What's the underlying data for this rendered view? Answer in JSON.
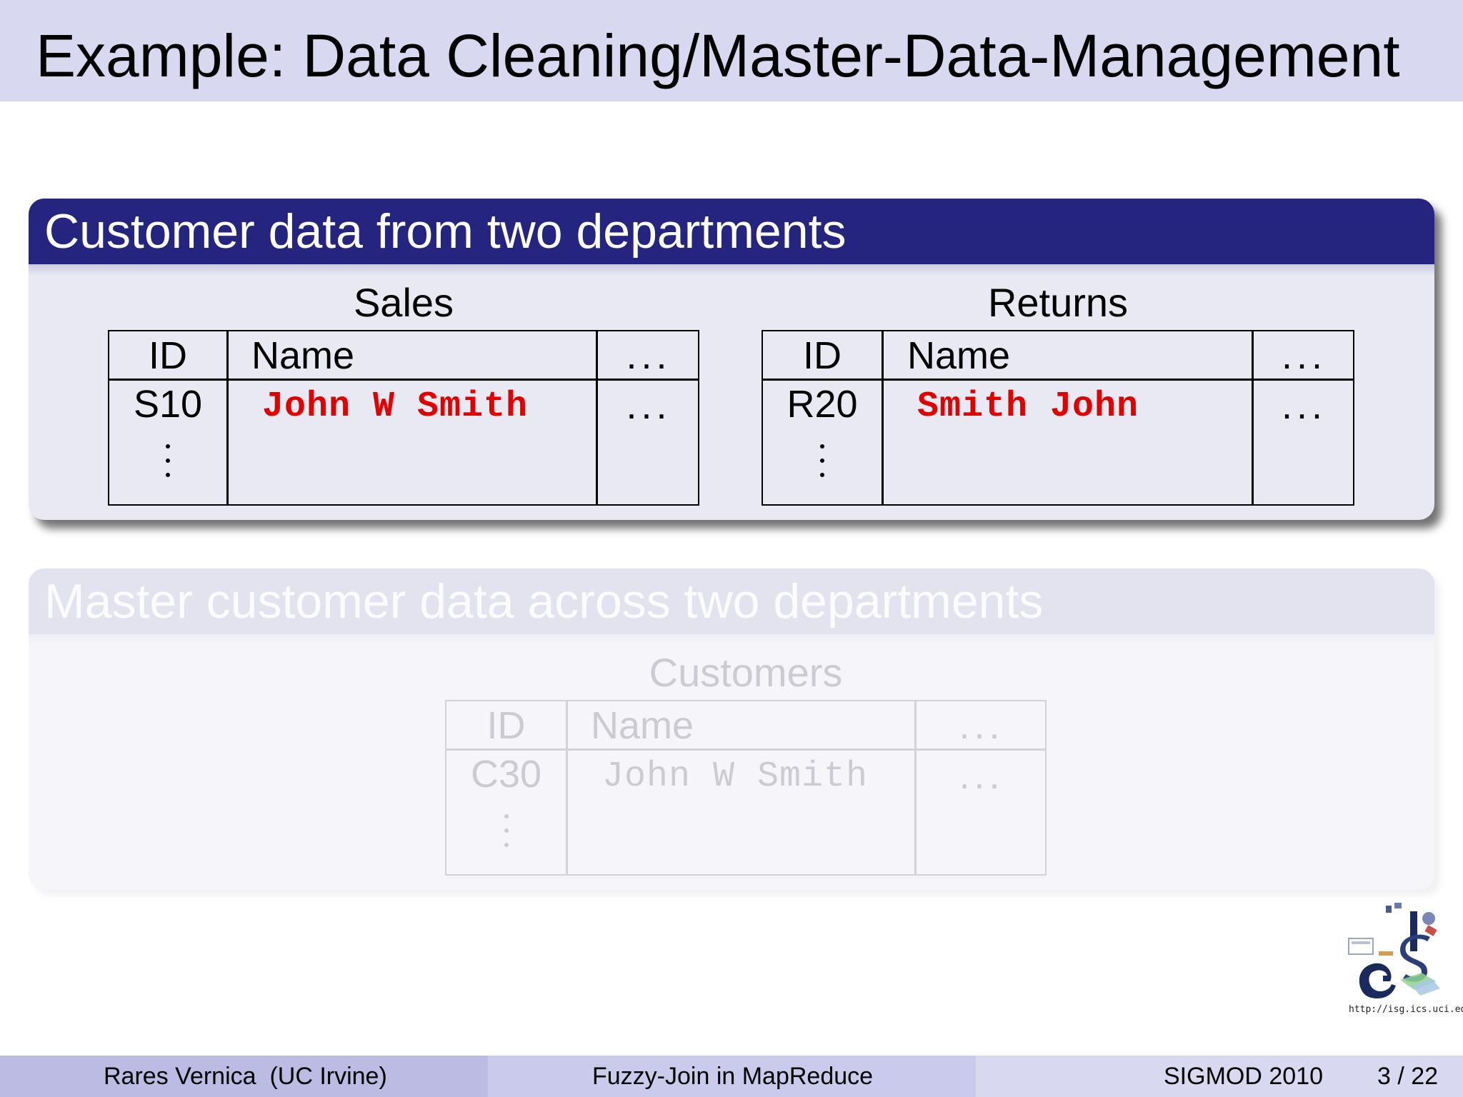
{
  "slide": {
    "title": "Example: Data Cleaning/Master-Data-Management"
  },
  "block_departments": {
    "header": "Customer data from two departments",
    "sales": {
      "caption": "Sales",
      "columns": [
        "ID",
        "Name",
        "..."
      ],
      "row": {
        "id": "S10",
        "name": "John W Smith",
        "more": "..."
      }
    },
    "returns": {
      "caption": "Returns",
      "columns": [
        "ID",
        "Name",
        "..."
      ],
      "row": {
        "id": "R20",
        "name": "Smith John",
        "more": "..."
      }
    }
  },
  "block_master": {
    "header": "Master customer data across two departments",
    "customers": {
      "caption": "Customers",
      "columns": [
        "ID",
        "Name",
        "..."
      ],
      "row": {
        "id": "C30",
        "name": "John W Smith",
        "more": "..."
      }
    }
  },
  "logo": {
    "url": "http://isg.ics.uci.edu",
    "letters": "ISG"
  },
  "footer": {
    "author": "Rares Vernica  (UC Irvine)",
    "talk_title": "Fuzzy-Join in MapReduce",
    "venue": "SIGMOD 2010",
    "page": "3 / 22"
  },
  "colors": {
    "header_bar": "#d8d8f0",
    "block_title": "#252580",
    "highlight_text": "#e10000",
    "footer_left": "#bbbbe3",
    "footer_mid": "#cacaec",
    "footer_right": "#d8d8f0"
  }
}
